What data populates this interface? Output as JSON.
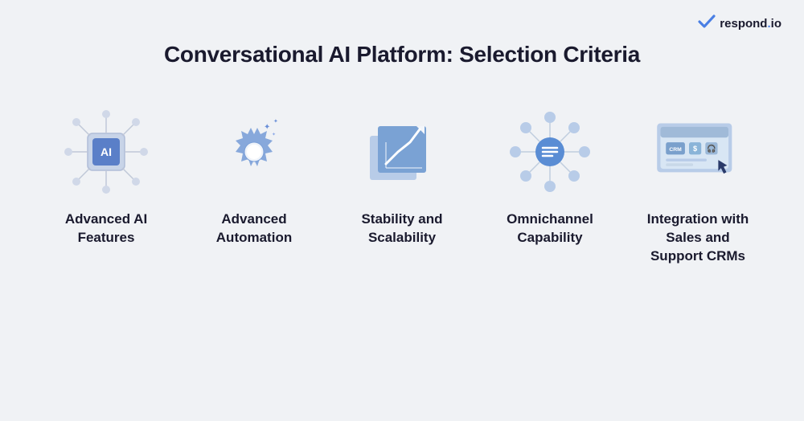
{
  "logo": {
    "check": "✓",
    "text_pre": "respond",
    "text_dot": ".",
    "text_post": "io"
  },
  "title": "Conversational AI Platform: Selection Criteria",
  "cards": [
    {
      "id": "advanced-ai",
      "label": "Advanced AI\nFeatures"
    },
    {
      "id": "advanced-automation",
      "label": "Advanced\nAutomation"
    },
    {
      "id": "stability-scalability",
      "label": "Stability and\nScalability"
    },
    {
      "id": "omnichannel",
      "label": "Omnichannel\nCapability"
    },
    {
      "id": "integration-crm",
      "label": "Integration with\nSales and\nSupport CRMs"
    }
  ]
}
